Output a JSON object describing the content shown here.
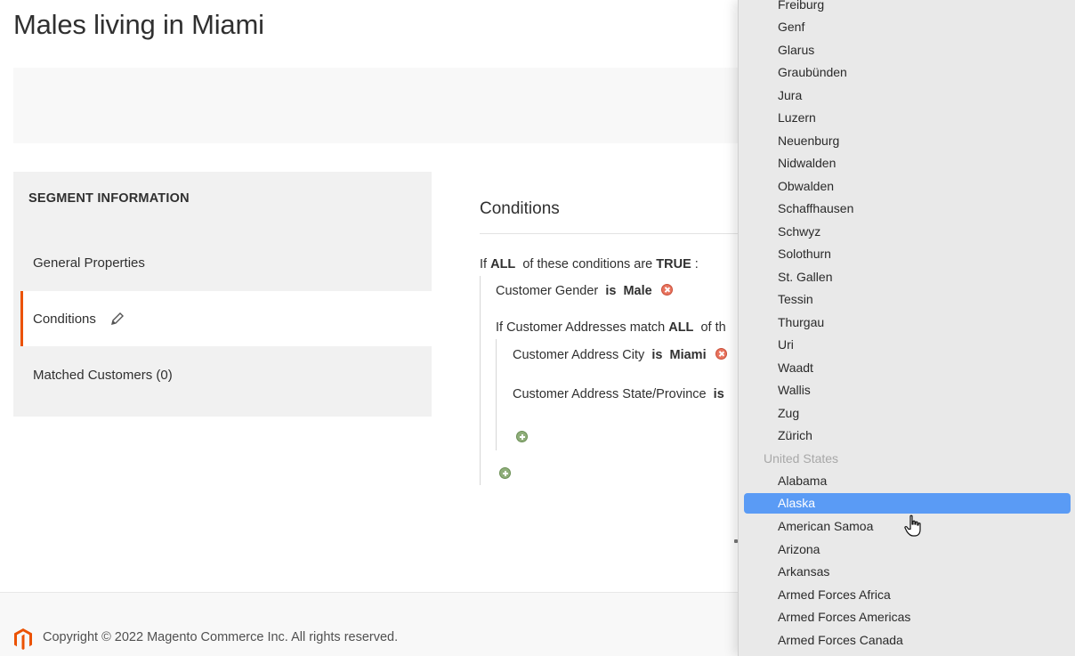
{
  "page": {
    "title": "Males living in Miami"
  },
  "side_tabs": {
    "section_title": "SEGMENT INFORMATION",
    "items": [
      {
        "label": "General Properties"
      },
      {
        "label": "Conditions"
      },
      {
        "label": "Matched Customers (0)"
      }
    ]
  },
  "conditions": {
    "title": "Conditions",
    "root_prefix": "If",
    "root_aggregator": "ALL",
    "root_mid": "of these conditions are",
    "root_value": "TRUE",
    "root_suffix": ":",
    "gender": {
      "attribute": "Customer Gender",
      "operator": "is",
      "value": "Male"
    },
    "address_group": {
      "prefix": "If Customer Addresses match",
      "aggregator": "ALL",
      "suffix": "of th"
    },
    "city": {
      "attribute": "Customer Address City",
      "operator": "is",
      "value": "Miami"
    },
    "state": {
      "attribute": "Customer Address State/Province",
      "operator": "is"
    }
  },
  "footer": {
    "copyright": "Copyright © 2022 Magento Commerce Inc. All rights reserved."
  },
  "colors": {
    "accent": "#eb5202",
    "selection": "#5a9bf5",
    "remove": "#e8735e",
    "add": "#8fae7a"
  },
  "dropdown": {
    "items": [
      {
        "label": "Freiburg",
        "type": "option"
      },
      {
        "label": "Genf",
        "type": "option"
      },
      {
        "label": "Glarus",
        "type": "option"
      },
      {
        "label": "Graubünden",
        "type": "option"
      },
      {
        "label": "Jura",
        "type": "option"
      },
      {
        "label": "Luzern",
        "type": "option"
      },
      {
        "label": "Neuenburg",
        "type": "option"
      },
      {
        "label": "Nidwalden",
        "type": "option"
      },
      {
        "label": "Obwalden",
        "type": "option"
      },
      {
        "label": "Schaffhausen",
        "type": "option"
      },
      {
        "label": "Schwyz",
        "type": "option"
      },
      {
        "label": "Solothurn",
        "type": "option"
      },
      {
        "label": "St. Gallen",
        "type": "option"
      },
      {
        "label": "Tessin",
        "type": "option"
      },
      {
        "label": "Thurgau",
        "type": "option"
      },
      {
        "label": "Uri",
        "type": "option"
      },
      {
        "label": "Waadt",
        "type": "option"
      },
      {
        "label": "Wallis",
        "type": "option"
      },
      {
        "label": "Zug",
        "type": "option"
      },
      {
        "label": "Zürich",
        "type": "option"
      },
      {
        "label": "United States",
        "type": "group"
      },
      {
        "label": "Alabama",
        "type": "option"
      },
      {
        "label": "Alaska",
        "type": "selected"
      },
      {
        "label": "American Samoa",
        "type": "option"
      },
      {
        "label": "Arizona",
        "type": "option"
      },
      {
        "label": "Arkansas",
        "type": "option"
      },
      {
        "label": "Armed Forces Africa",
        "type": "option"
      },
      {
        "label": "Armed Forces Americas",
        "type": "option"
      },
      {
        "label": "Armed Forces Canada",
        "type": "option"
      }
    ]
  }
}
